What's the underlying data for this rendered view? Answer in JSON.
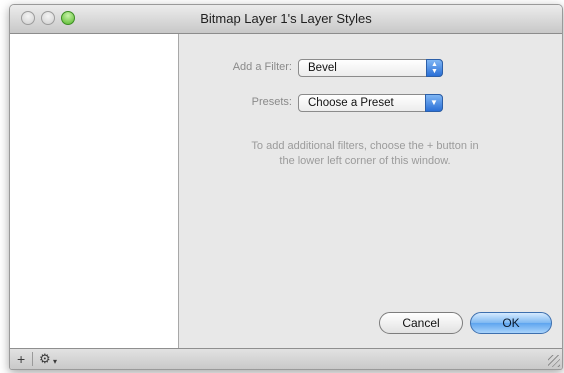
{
  "window": {
    "title": "Bitmap Layer 1's Layer Styles"
  },
  "filter": {
    "label": "Add a Filter:",
    "value": "Bevel"
  },
  "presets": {
    "label": "Presets:",
    "value": "Choose a Preset"
  },
  "info": {
    "line1": "To add additional filters, choose the + button in",
    "line2": "the lower left corner of this window."
  },
  "buttons": {
    "cancel": "Cancel",
    "ok": "OK"
  },
  "bottombar": {
    "add_symbol": "+",
    "gear_symbol": "⚙",
    "caret_symbol": "▾"
  },
  "icons": {
    "stepper_up": "▲",
    "stepper_down": "▼",
    "dropdown": "▼"
  }
}
